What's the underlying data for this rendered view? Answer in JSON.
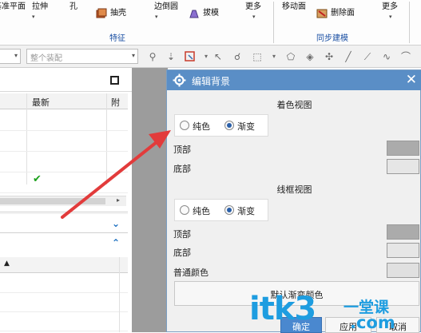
{
  "ribbon": {
    "items": [
      {
        "label": "基准平面"
      },
      {
        "label": "拉伸"
      },
      {
        "label": "孔"
      },
      {
        "label": "抽壳"
      },
      {
        "label": "边倒圆"
      },
      {
        "label": "拔模"
      },
      {
        "label": "更多"
      },
      {
        "label": "移动面"
      },
      {
        "label": "删除面"
      },
      {
        "label": "更多"
      }
    ],
    "groups": {
      "feature": "特征",
      "sync_modeling": "同步建模"
    }
  },
  "toolbar": {
    "combo1_value": "",
    "assembly_placeholder": "整个装配"
  },
  "left_panel": {
    "columns": [
      "最新",
      "附"
    ],
    "rows_checked": [
      false,
      false,
      false,
      true,
      false
    ],
    "lower_rows": 3
  },
  "dialog": {
    "title": "编辑背景",
    "shaded_view": {
      "title": "着色视图",
      "options": [
        "纯色",
        "渐变"
      ],
      "selected": "渐变",
      "top_label": "顶部",
      "bottom_label": "底部",
      "top_color": "#ababab",
      "bottom_color": "#e6e6e6"
    },
    "wireframe_view": {
      "title": "线框视图",
      "options": [
        "纯色",
        "渐变"
      ],
      "selected": "渐变",
      "top_label": "顶部",
      "bottom_label": "底部",
      "normal_color_label": "普通颜色",
      "top_color": "#ababab",
      "bottom_color": "#e6e6e6",
      "normal_color": "#e0e0e0"
    },
    "default_gradient_button": "默认渐变颜色",
    "buttons": {
      "ok": "确定",
      "apply": "应用",
      "cancel": "取消"
    }
  },
  "watermark": {
    "logo": "itk3",
    "subtitle": "一堂课",
    "url": ".com"
  },
  "colors": {
    "title_bar": "#5a8ec6",
    "accent_blue": "#1a4fa3",
    "arrow": "#e23b3b",
    "checkmark": "#1aa01a"
  }
}
